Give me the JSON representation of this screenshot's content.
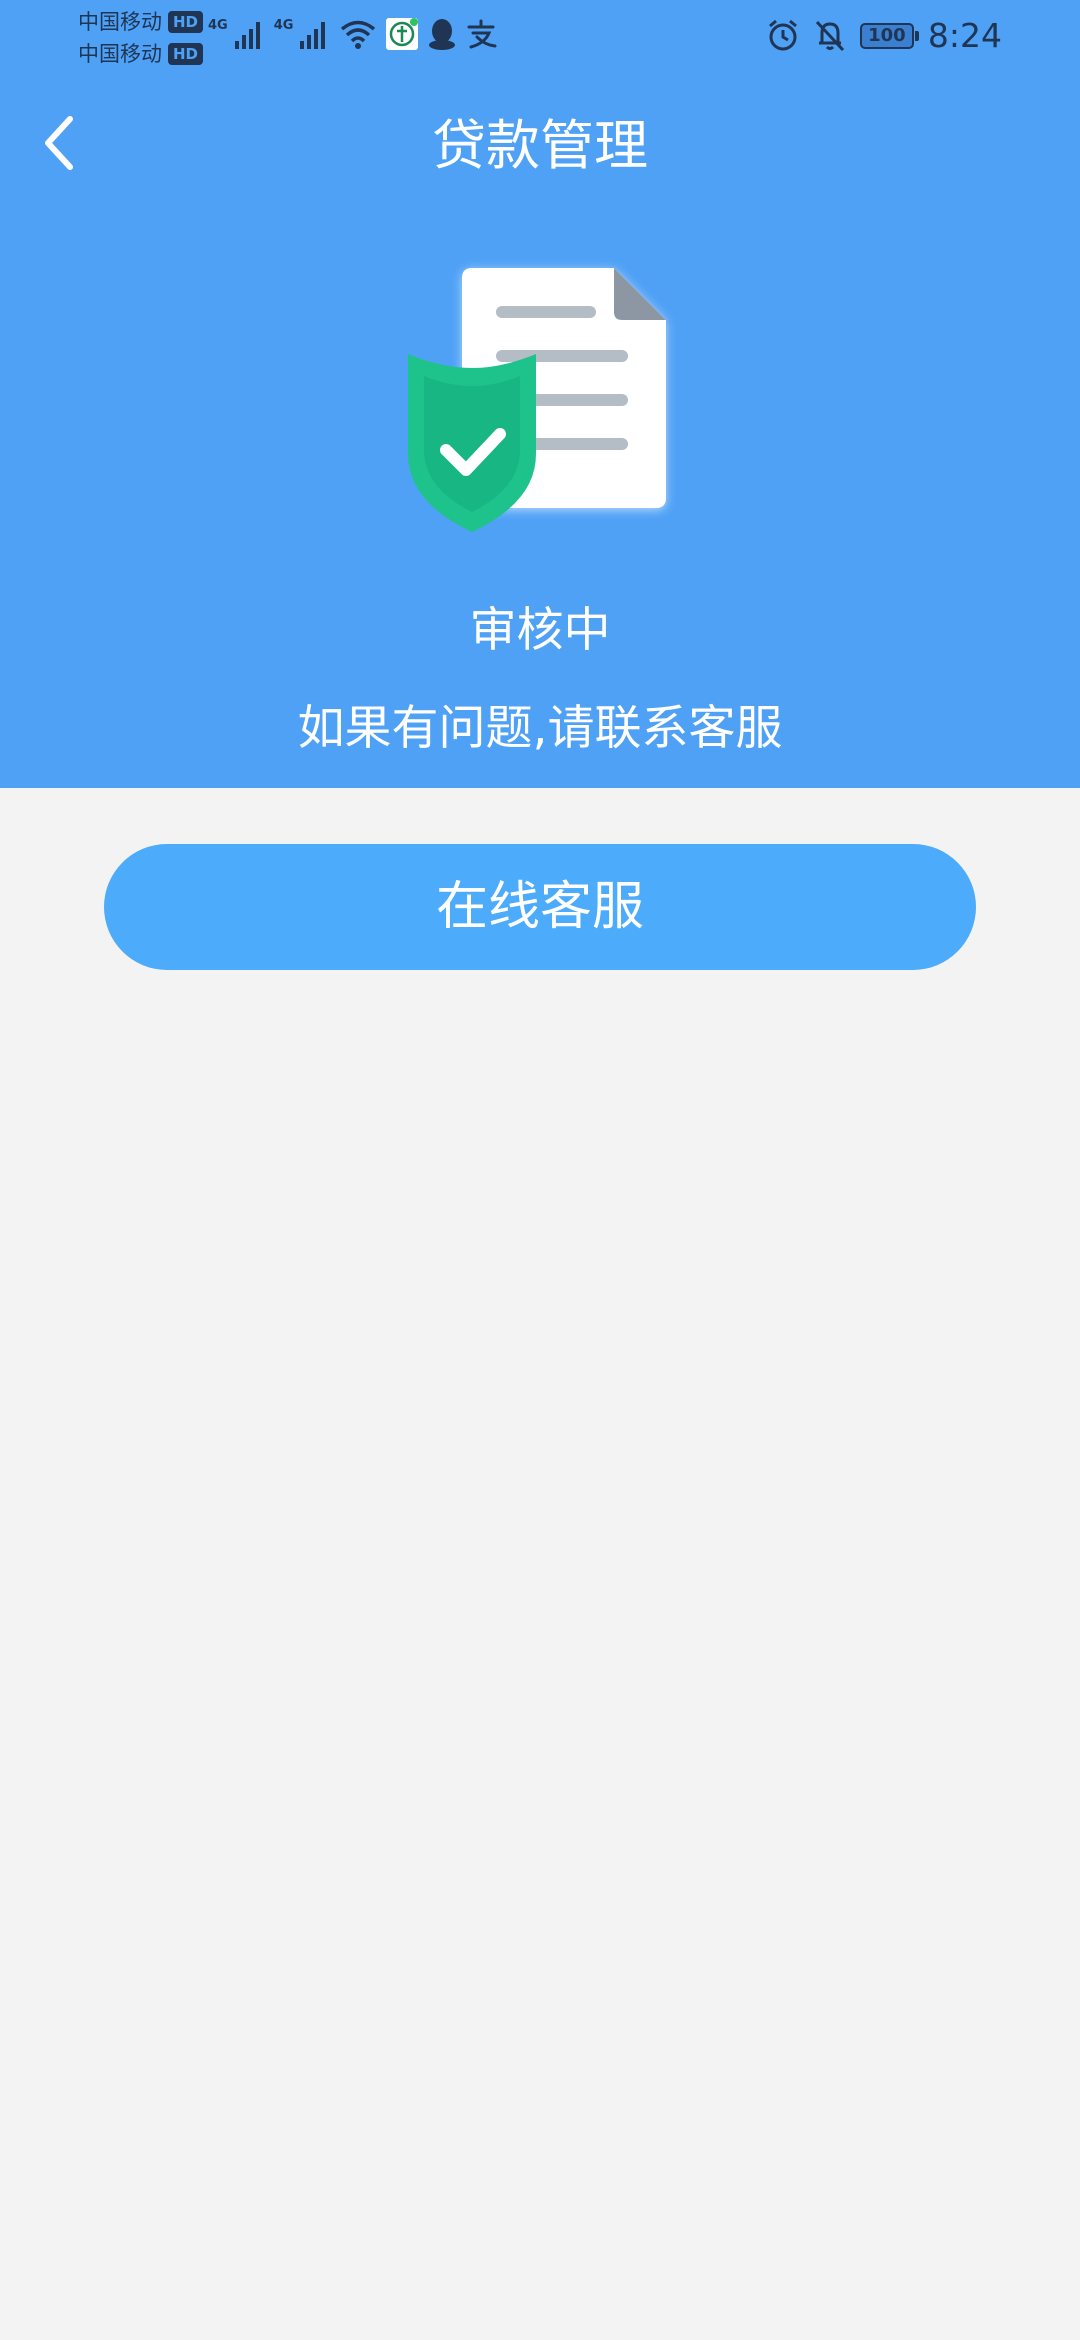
{
  "status_bar": {
    "carriers": [
      {
        "name": "中国移动",
        "badge": "HD"
      },
      {
        "name": "中国移动",
        "badge": "HD"
      }
    ],
    "signal_labels": [
      "4G",
      "4G"
    ],
    "left_icons": [
      "signal-icon",
      "signal-icon",
      "wifi-icon",
      "app-notification-icon",
      "qq-icon",
      "alipay-icon"
    ],
    "right_icons": [
      "alarm-icon",
      "mute-icon",
      "battery-icon"
    ],
    "battery": "100",
    "time": "8:24"
  },
  "nav": {
    "back_icon": "chevron-left-icon",
    "title": "贷款管理"
  },
  "review": {
    "illustration": "document-shield-check-icon",
    "status": "审核中",
    "message": "如果有问题,请联系客服"
  },
  "actions": {
    "customer_service_label": "在线客服"
  },
  "colors": {
    "header_bg": "#4fa1f6",
    "button_bg": "#4dabfb",
    "page_bg": "#f3f3f3",
    "shield": "#1ec38c",
    "status_bar_text": "#1f3553"
  }
}
